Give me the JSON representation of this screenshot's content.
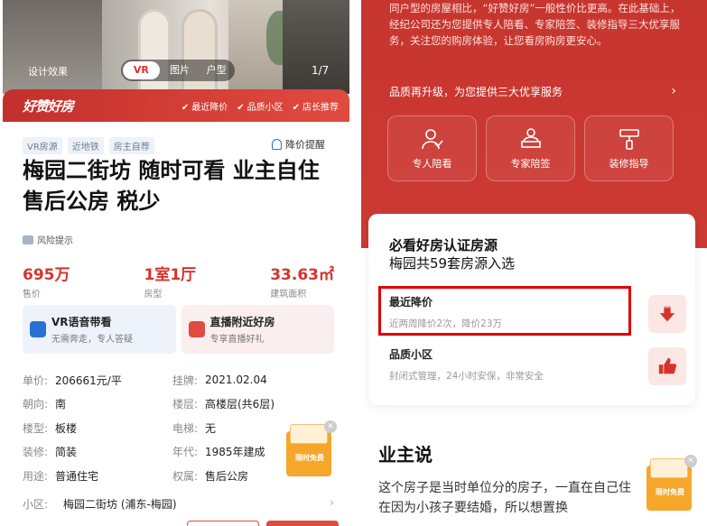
{
  "left": {
    "hero": {
      "design_label": "设计效果",
      "tabs": [
        "VR",
        "图片",
        "户型"
      ],
      "page": "1/7"
    },
    "ribbon": {
      "brand": "好赞好房",
      "tags": [
        "最近降价",
        "品质小区",
        "店长推荐"
      ]
    },
    "chips": [
      "VR房源",
      "近地铁",
      "房主自荐"
    ],
    "price_alert": "降价提醒",
    "title": "梅园二街坊 随时可看 业主自住 售后公房 税少",
    "risk": "风险提示",
    "stats": [
      {
        "value": "695万",
        "label": "售价"
      },
      {
        "value": "1室1厅",
        "label": "房型"
      },
      {
        "value": "33.63㎡",
        "label": "建筑面积"
      }
    ],
    "cards": [
      {
        "title": "VR语音带看",
        "sub": "无需奔走，专人答疑"
      },
      {
        "title": "直播附近好房",
        "sub": "专享直播好礼"
      }
    ],
    "info": [
      {
        "k": "单价:",
        "v": "206661元/平",
        "k2": "挂牌:",
        "v2": "2021.02.04"
      },
      {
        "k": "朝向:",
        "v": "南",
        "k2": "楼层:",
        "v2": "高楼层(共6层)"
      },
      {
        "k": "楼型:",
        "v": "板楼",
        "k2": "电梯:",
        "v2": "无"
      },
      {
        "k": "装修:",
        "v": "简装",
        "k2": "年代:",
        "v2": "1985年建成"
      },
      {
        "k": "用途:",
        "v": "普通住宅",
        "k2": "权属:",
        "v2": "售后公房"
      }
    ],
    "community": {
      "k": "小区:",
      "v": "梅园二街坊 (浦东-梅园)"
    },
    "promo": "限时免费"
  },
  "right": {
    "intro": "同户型的房屋相比，“好赞好房”一般性价比更高。在此基础上，经纪公司还为您提供专人陪看、专家陪签、装修指导三大优享服务，关注您的购房体验，让您看房购房更安心。",
    "upgrade": "品质再升级，为您提供三大优享服务",
    "services": [
      "专人陪看",
      "专家陪签",
      "装修指导"
    ],
    "cert": {
      "title": "必看好房认证房源",
      "subtitle": "梅园共59套房源入选",
      "features": [
        {
          "title": "最近降价",
          "desc": "近两周降价2次，降价23万"
        },
        {
          "title": "品质小区",
          "desc": "封闭式管理，24小时安保，非常安全"
        }
      ]
    },
    "owner_heading": "业主说",
    "owner_text": "这个房子是当时单位分的房子，一直在自己住在因为小孩子要结婚，所以想置换",
    "promo": "限时免费"
  },
  "colors": {
    "brand_red": "#d8322c",
    "highlight_box": "#e10000"
  }
}
